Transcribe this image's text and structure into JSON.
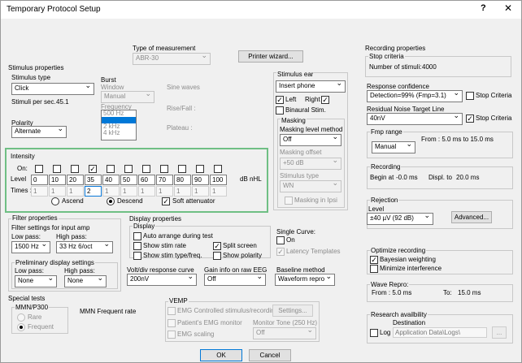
{
  "window": {
    "title": "Temporary Protocol Setup",
    "help": "?",
    "close": "✕"
  },
  "measurement": {
    "label": "Type of measurement",
    "value": "ABR-30"
  },
  "printer_wizard": "Printer wizard...",
  "stimulus": {
    "group": "Stimulus properties",
    "type_label": "Stimulus type",
    "type_value": "Click",
    "per_sec_label": "Stimuli per sec.",
    "per_sec_value": "45.1",
    "polarity_label": "Polarity",
    "polarity_value": "Alternate"
  },
  "burst": {
    "group": "Burst",
    "window_label": "Window",
    "window_value": "Manual",
    "frequency_label": "Frequency",
    "frequency_items": [
      "500 Hz",
      "1 kHz",
      "2 kHz",
      "4 kHz"
    ],
    "sine_waves": "Sine waves",
    "rise_fall": "Rise/Fall :",
    "plateau": "Plateau :"
  },
  "intensity": {
    "group": "Intensity",
    "on_label": "On:",
    "level_label": "Level",
    "times_label": "Times :",
    "levels": [
      "0",
      "10",
      "20",
      "35",
      "40",
      "50",
      "60",
      "70",
      "80",
      "90",
      "100"
    ],
    "times": [
      "1",
      "1",
      "1",
      "2",
      "1",
      "1",
      "1",
      "1",
      "1",
      "1",
      "1"
    ],
    "on_checked": [
      false,
      false,
      false,
      true,
      false,
      false,
      false,
      false,
      false,
      false,
      false
    ],
    "unit": "dB nHL",
    "ascend": "Ascend",
    "descend": "Descend",
    "soft_attenuator": "Soft attenuator"
  },
  "stimulus_ear": {
    "group": "Stimulus ear",
    "value": "Insert phone",
    "left": "Left",
    "right": "Right",
    "binaural": "Binaural Stim.",
    "masking_group": "Masking",
    "masking_method_label": "Masking level method",
    "masking_method_value": "Off",
    "offset_label": "Masking offset",
    "offset_value": "+50 dB",
    "stimulus_type_label": "Stimulus type",
    "stimulus_type_value": "WN",
    "masking_ipsi": "Masking in Ipsi"
  },
  "filter": {
    "group": "Filter properties",
    "settings_label": "Filter settings for input amp",
    "low_pass_label": "Low pass:",
    "low_pass_value": "1500 Hz",
    "high_pass_label": "High pass:",
    "high_pass_value": "33 Hz 6/oct",
    "prelim_label": "Preliminary display settings",
    "prelim_low_label": "Low pass:",
    "prelim_low_value": "None",
    "prelim_high_label": "High pass:",
    "prelim_high_value": "None"
  },
  "display": {
    "group": "Display properties",
    "display_label": "Display",
    "auto_arrange": "Auto arrange during test",
    "show_stim_rate": "Show stim rate",
    "show_stim_type": "Show stim type/freq.",
    "split_screen": "Split screen",
    "show_polarity": "Show polarity",
    "single_curve_label": "Single Curve:",
    "single_curve_on": "On",
    "latency_templates": "Latency Templates",
    "volt_label": "Volt/div response curve",
    "volt_value": "200nV",
    "gain_label": "Gain info on raw EEG",
    "gain_value": "Off",
    "baseline_label": "Baseline method",
    "baseline_value": "Waveform repro"
  },
  "special": {
    "group": "Special tests",
    "mmn_label": "MMN/P300",
    "rare": "Rare",
    "frequent": "Frequent",
    "mmn_rate": "MMN Frequent rate"
  },
  "vemp": {
    "group": "VEMP",
    "emg_controlled": "EMG Controlled stimulus/recording",
    "settings": "Settings...",
    "patient_emg": "Patient's EMG monitor",
    "monitor_tone": "Monitor Tone (250 Hz)",
    "emg_scaling": "EMG scaling",
    "off": "Off"
  },
  "recording": {
    "group": "Recording properties",
    "stop_criteria_label": "Stop criteria",
    "num_stimuli_label": "Number of stimuli:",
    "num_stimuli_value": "4000",
    "response_conf_label": "Response confidence",
    "response_conf_value": "Detection=99% (Fmp=3.1)",
    "stop_criteria_cb": "Stop Criteria",
    "residual_label": "Residual Noise Target Line",
    "residual_value": "40nV",
    "stop_criteria_cb2": "Stop Criteria",
    "fmp_label": "Fmp range",
    "fmp_value": "Manual",
    "fmp_range": "From : 5.0 ms to 15.0 ms",
    "rec_label": "Recording",
    "begin_label": "Begin at",
    "begin_value": "-0.0 ms",
    "displ_label": "Displ. to",
    "displ_value": "20.0 ms",
    "rejection_label": "Rejection",
    "level_label": "Level",
    "level_value": "±40 µV (92 dB)",
    "advanced": "Advanced...",
    "optimize_label": "Optimize recording",
    "bayesian": "Bayesian weighting",
    "min_interference": "Minimize interference",
    "wave_repro_label": "Wave Repro:",
    "wave_from": "From : 5.0 ms",
    "wave_to": "To:",
    "wave_to_value": "15.0 ms",
    "research_label": "Research availbility",
    "destination_label": "Destination",
    "log": "Log",
    "destination_value": "Application Data\\Logs\\",
    "browse": "..."
  },
  "ok": "OK",
  "cancel": "Cancel"
}
